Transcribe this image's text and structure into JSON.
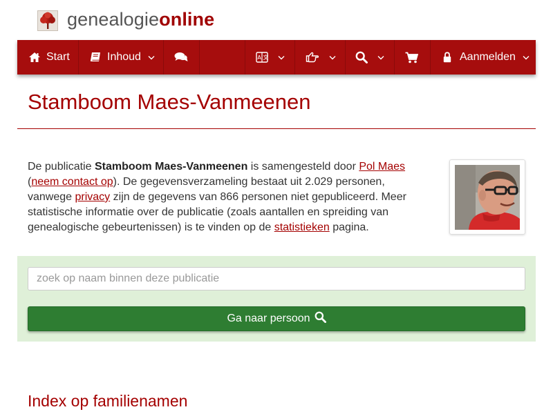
{
  "brand": {
    "name_regular": "genealogie",
    "name_strong": "online"
  },
  "nav": {
    "start": "Start",
    "inhoud": "Inhoud",
    "login": "Aanmelden"
  },
  "icons": {
    "home": "home-icon",
    "book": "book-icon",
    "comments": "comments-icon",
    "language": "language-icon",
    "hand": "hand-pointer-icon",
    "search": "search-icon",
    "cart": "cart-icon",
    "lock": "lock-icon",
    "chevron": "chevron-down-icon"
  },
  "colors": {
    "brand_red": "#a40000",
    "navbar_bg": "#a60d0d",
    "panel_bg": "#dff0d8",
    "button_green": "#2e7d32"
  },
  "page": {
    "title": "Stamboom Maes-Vanmeenen",
    "intro": {
      "t1": "De publicatie ",
      "pub_name": "Stamboom Maes-Vanmeenen",
      "t2": " is samengesteld door ",
      "author_link": "Pol Maes",
      "t3": " (",
      "contact_link": "neem contact op",
      "t4": "). De gegevensverzameling bestaat uit 2.029 personen, vanwege ",
      "privacy_link": "privacy",
      "t5": " zijn de gegevens van 866 personen niet gepubliceerd. Meer statistische informatie over de publicatie (zoals aantallen en spreiding van genealogische gebeurtenissen) is te vinden op de ",
      "stats_link": "statistieken",
      "t6": " pagina."
    }
  },
  "search": {
    "placeholder": "zoek op naam binnen deze publicatie",
    "value": "",
    "button_label": "Ga naar persoon"
  },
  "sections": {
    "index_title": "Index op familienamen"
  }
}
